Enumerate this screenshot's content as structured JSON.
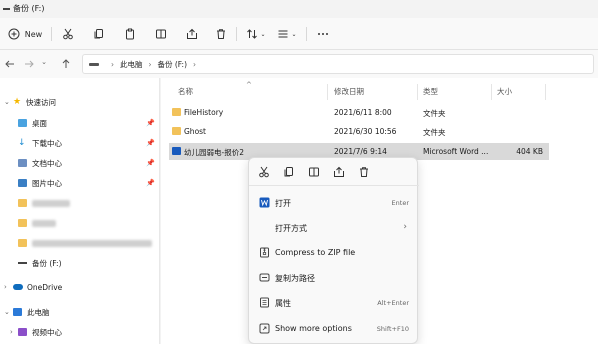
{
  "window": {
    "title": "备份 (F:)"
  },
  "toolbar": {
    "new_label": "New"
  },
  "address": {
    "crumbs": [
      "此电脑",
      "备份 (F:)"
    ]
  },
  "sidebar": {
    "quick_access": "快速访问",
    "items": [
      {
        "label": "桌面"
      },
      {
        "label": "下载中心"
      },
      {
        "label": "文档中心"
      },
      {
        "label": "图片中心"
      }
    ],
    "drive": "备份 (F:)",
    "onedrive": "OneDrive",
    "this_pc": "此电脑",
    "videos": "视频中心"
  },
  "columns": {
    "name": "名称",
    "modified": "修改日期",
    "type": "类型",
    "size": "大小"
  },
  "files": [
    {
      "name": "FileHistory",
      "modified": "2021/6/11 8:00",
      "type": "文件夹",
      "size": "",
      "icon": "folder-icon"
    },
    {
      "name": "Ghost",
      "modified": "2021/6/30 10:56",
      "type": "文件夹",
      "size": "",
      "icon": "folder-icon"
    },
    {
      "name": "幼儿园弱电-报价2",
      "modified": "2021/7/6 9:14",
      "type": "Microsoft Word ...",
      "size": "404 KB",
      "icon": "word-file-icon",
      "selected": true
    }
  ],
  "context_menu": {
    "items": [
      {
        "label": "打开",
        "shortcut": "Enter"
      },
      {
        "label": "打开方式",
        "shortcut": ""
      },
      {
        "label": "Compress to ZIP file",
        "shortcut": ""
      },
      {
        "label": "复制为路径",
        "shortcut": ""
      },
      {
        "label": "属性",
        "shortcut": "Alt+Enter"
      },
      {
        "label": "Show more options",
        "shortcut": "Shift+F10"
      }
    ]
  },
  "colors": {
    "folder": "#f2c25a",
    "word": "#185abd",
    "selection": "#d9d9d9",
    "star": "#f5b800",
    "onedrive": "#0f6cbd"
  }
}
